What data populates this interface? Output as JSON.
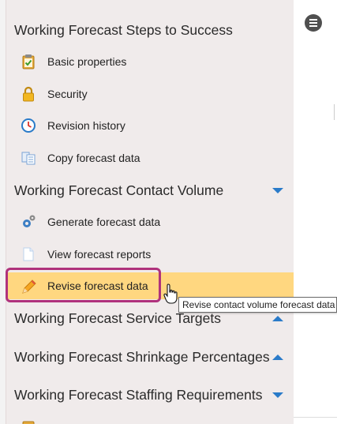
{
  "sidebar": {
    "sections": [
      {
        "label": "Working Forecast Steps to Success"
      },
      {
        "label": "Working Forecast Contact Volume"
      },
      {
        "label": "Working Forecast Service Targets"
      },
      {
        "label": "Working Forecast Shrinkage Percentages"
      },
      {
        "label": "Working Forecast Staffing Requirements"
      }
    ],
    "steps_items": [
      {
        "label": "Basic properties",
        "icon": "clipboard-check-icon"
      },
      {
        "label": "Security",
        "icon": "lock-icon"
      },
      {
        "label": "Revision history",
        "icon": "clock-history-icon"
      },
      {
        "label": "Copy forecast data",
        "icon": "copy-document-icon"
      }
    ],
    "volume_items": [
      {
        "label": "Generate forecast data",
        "icon": "gears-icon"
      },
      {
        "label": "View forecast reports",
        "icon": "document-icon"
      },
      {
        "label": "Revise forecast data",
        "icon": "pencil-icon",
        "active": true
      }
    ]
  },
  "tooltip": {
    "text": "Revise contact volume forecast data"
  },
  "colors": {
    "sidebar_bg": "#f0ebeb",
    "active_bg": "#ffd780",
    "highlight_border": "#b0327c",
    "chevron": "#2a7bc9"
  }
}
